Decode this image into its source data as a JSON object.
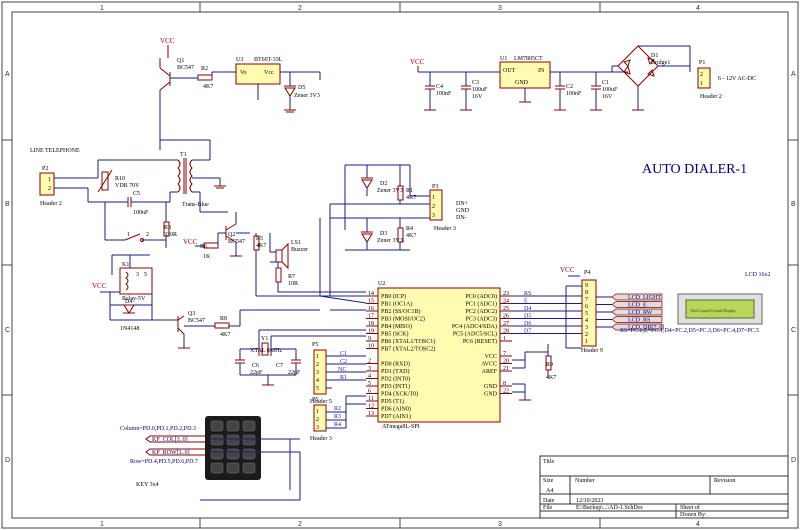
{
  "title": "AUTO DIALER-1",
  "zones": {
    "cols": [
      "1",
      "2",
      "3",
      "4"
    ],
    "rows": [
      "A",
      "B",
      "C",
      "D"
    ]
  },
  "power": {
    "vcc": "VCC",
    "ac": "6 - 12V AC-DC"
  },
  "parts": {
    "q1": "Q1",
    "q1v": "BC547",
    "r2": "R2",
    "r2v": "4K7",
    "u3": "U3",
    "u3v": "BT66T-33L",
    "u3out": "Vo",
    "u3in": "Vcc",
    "d5": "D5",
    "d5v": "Zener 3V3",
    "u1": "U1",
    "u1v": "LM7805CT",
    "u1out": "OUT",
    "u1in": "IN",
    "u1gnd": "GND",
    "c4": "C4",
    "c4v": "100nF",
    "c3": "C3",
    "c3v": "100uF",
    "c3v2": "16V",
    "c2": "C2",
    "c2v": "100nF",
    "c1": "C1",
    "c1v": "100uF",
    "c1v2": "16V",
    "d1": "D1",
    "d1v": "Bridge1",
    "p1": "P1",
    "p1v": "Header 2",
    "line": "LINE TELEPHONE",
    "p2": "P2",
    "p2v": "Header 2",
    "r10": "R10",
    "r10v": "VDR 70V",
    "t1": "T1",
    "t1v": "Trans-Blue",
    "c5": "C5",
    "c5v": "100nF",
    "r3": "R3",
    "r3v": "330R",
    "q2": "Q2",
    "q2v": "BC547",
    "r6": "R6",
    "r6v": "1K",
    "r5": "R5",
    "r5v": "4K7",
    "ls1": "LS1",
    "ls1v": "Buzzer",
    "r7": "R7",
    "r7v": "10R",
    "d2": "D2",
    "d2v": "Zener 3V3",
    "r1": "R1",
    "r1v": "4K7",
    "d3": "D3",
    "d3v": "Zener 3V3",
    "r4": "R4",
    "r4v": "4K7",
    "p3": "P3",
    "p3v": "Header 3",
    "dinp": "DN+",
    "gnd": "GND",
    "dinm": "DN-",
    "k1": "K1",
    "k1v": "Relay-5V",
    "d4": "D4",
    "d4v": "1N4148",
    "q3": "Q3",
    "q3v": "BC547",
    "r8": "R8",
    "r8v": "4K7",
    "y1": "Y1",
    "y1v": "XTAL 8MHz",
    "c6": "C6",
    "c6v": "22pF",
    "c7": "C7",
    "c7v": "22pF",
    "u2": "U2",
    "u2v": "ATmega8L-SPI",
    "p5": "P5",
    "p5v": "Header 5",
    "p6": "P6",
    "p6v": "Header 3",
    "p4": "P4",
    "p4v": "Header 9",
    "r9": "R9",
    "r9v": "4K7",
    "lcd": "LCD 16x2",
    "lcdtext": "16x2 Liquid Crystal Display",
    "key": "KEY 3x4"
  },
  "mcu_left": [
    "PB0 (ICP)",
    "PB1 (OC1A)",
    "PB2 (SS/OC1B)",
    "PB3 (MOSI/OC2)",
    "PB4 (MISO)",
    "PB5 (SCK)",
    "PB6 (XTAL1/TOSC1)",
    "PB7 (XTAL2/TOSC2)",
    "",
    "PD0 (RXD)",
    "PD1 (TXD)",
    "PD2 (INT0)",
    "PD3 (INT1)",
    "PD4 (XCK/T0)",
    "PD5 (T1)",
    "PD6 (AIN0)",
    "PD7 (AIN1)"
  ],
  "mcu_right": [
    "PC0 (ADC0)",
    "PC1 (ADC1)",
    "PC2 (ADC2)",
    "PC3 (ADC3)",
    "PC4 (ADC4/SDA)",
    "PC5 (ADC5/SCL)",
    "PC6 (RESET)",
    "",
    "VCC",
    "AVCC",
    "AREF",
    "",
    "GND",
    "GND"
  ],
  "mcu_pins_left": [
    "14",
    "15",
    "16",
    "17",
    "18",
    "19",
    "9",
    "10",
    "",
    "2",
    "3",
    "4",
    "5",
    "6",
    "11",
    "12",
    "13"
  ],
  "mcu_pins_right": [
    "23",
    "24",
    "25",
    "26",
    "27",
    "28",
    "1",
    "",
    "7",
    "20",
    "21",
    "",
    "8",
    "22"
  ],
  "left_nets": [
    "C1",
    "C2",
    "NC",
    "R1",
    "",
    "",
    "",
    ""
  ],
  "right_nets": [
    "RS",
    "E",
    "D4",
    "D5",
    "D6",
    "D7"
  ],
  "lcd_labels": [
    "LCD_LIGHT",
    "LCD_E",
    "LCD_RW",
    "LCD_RS",
    "LCD_DB[7..0]"
  ],
  "lcd_map": "RS=PC.0,E=PC.1,D4=PC.2,D5=PC.3,D6=PC.4,D7=PC.5",
  "keypad": {
    "cols": "Column=PD.0,PD.1,PD.2,PD.3",
    "cols_tag": "KP_COL[3..0]",
    "rows_tag": "KP_ROW[3..0]",
    "rows": "Row=PD.4,PD.5,PD.6,PD.7"
  },
  "titleblock": {
    "title_lbl": "Title",
    "size_lbl": "Size",
    "size": "A4",
    "number_lbl": "Number",
    "revision_lbl": "Revision",
    "date_lbl": "Date",
    "date": "12/10/2023",
    "file_lbl": "File",
    "file": "E:\\Backup\\...\\AD-1.SchDoc",
    "sheet_lbl": "Sheet   of",
    "drawn_lbl": "Drawn By:"
  }
}
